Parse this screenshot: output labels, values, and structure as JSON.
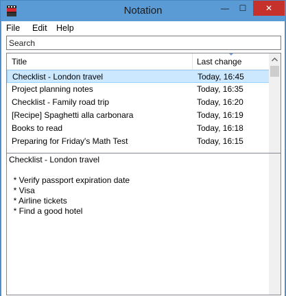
{
  "window": {
    "title": "Notation",
    "minimize_glyph": "—",
    "maximize_glyph": "☐",
    "close_glyph": "✕"
  },
  "menu": {
    "items": [
      {
        "label": "File"
      },
      {
        "label": "Edit"
      },
      {
        "label": "Help"
      }
    ]
  },
  "search": {
    "label": "Search"
  },
  "notes_list": {
    "columns": [
      "Title",
      "Last change"
    ],
    "rows": [
      {
        "title": "Checklist - London travel",
        "last_change": "Today, 16:45",
        "selected": true
      },
      {
        "title": "Project planning notes",
        "last_change": "Today, 16:35",
        "selected": false
      },
      {
        "title": "Checklist - Family road trip",
        "last_change": "Today, 16:20",
        "selected": false
      },
      {
        "title": "[Recipe] Spaghetti alla carbonara",
        "last_change": "Today, 16:19",
        "selected": false
      },
      {
        "title": "Books to read",
        "last_change": "Today, 16:18",
        "selected": false
      },
      {
        "title": "Preparing for Friday's Math Test",
        "last_change": "Today, 16:15",
        "selected": false
      }
    ]
  },
  "editor": {
    "content": "Checklist - London travel\n\n  * Verify passport expiration date\n  * Visa\n  * Airline tickets\n  * Find a good hotel"
  },
  "colors": {
    "titlebar": "#5b9bd5",
    "close_button": "#c7312c",
    "selection": "#cce8ff"
  },
  "icons": {
    "app": "notation-app-icon",
    "scroll_up": "chevron-up-icon",
    "scroll_down": "chevron-down-icon"
  }
}
